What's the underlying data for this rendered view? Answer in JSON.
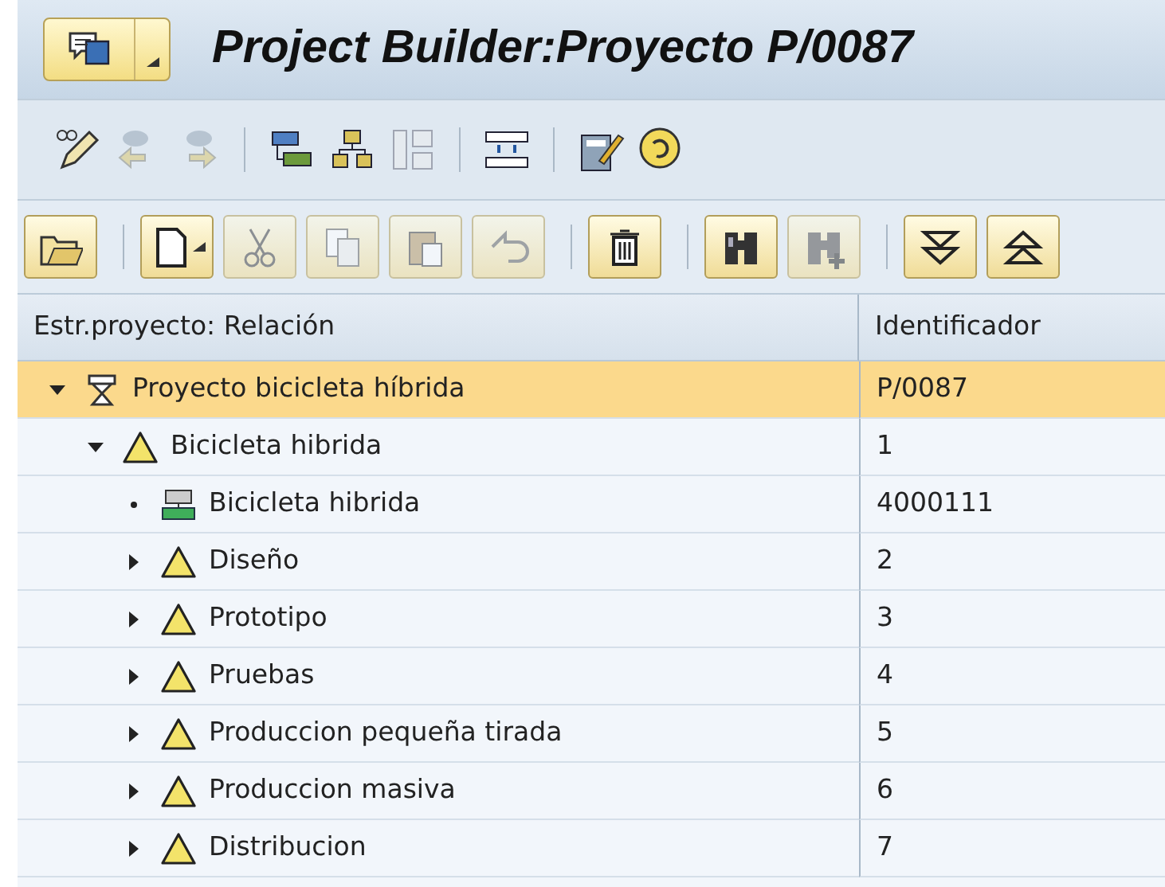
{
  "window": {
    "title": "Project Builder:Proyecto P/0087",
    "menu_button": {
      "disabled": false
    }
  },
  "toolbar": [
    [
      {
        "disabled": false
      },
      {
        "disabled": true
      },
      {
        "disabled": true
      }
    ],
    [
      {
        "disabled": false
      },
      {
        "disabled": false
      },
      {
        "disabled": true
      }
    ],
    [
      {
        "disabled": false
      }
    ],
    [
      {
        "disabled": false
      },
      {
        "disabled": false
      }
    ]
  ],
  "object_toolbar": [
    [
      {
        "disabled": false
      }
    ],
    [
      {
        "disabled": false
      },
      {
        "disabled": true
      },
      {
        "disabled": true
      },
      {
        "disabled": true
      },
      {
        "disabled": true
      }
    ],
    [
      {
        "disabled": false
      }
    ],
    [
      {
        "disabled": false
      },
      {
        "disabled": true
      }
    ],
    [
      {
        "disabled": false
      },
      {
        "disabled": false
      }
    ]
  ],
  "table": {
    "columns": [
      "Estr.proyecto: Relación",
      "Identificador"
    ],
    "rows": [
      {
        "kind": "project",
        "label": "Proyecto bicicleta híbrida",
        "id": "P/0087",
        "expanded": true,
        "selected": true,
        "children": [
          {
            "kind": "wbs",
            "label": "Bicicleta hibrida",
            "id": "1",
            "expanded": true,
            "selected": false,
            "children": [
              {
                "kind": "network",
                "label": "Bicicleta hibrida",
                "id": "4000111",
                "selected": false
              },
              {
                "kind": "wbs",
                "label": "Diseño",
                "id": "2",
                "expanded": false,
                "selected": false
              },
              {
                "kind": "wbs",
                "label": "Prototipo",
                "id": "3",
                "expanded": false,
                "selected": false
              },
              {
                "kind": "wbs",
                "label": "Pruebas",
                "id": "4",
                "expanded": false,
                "selected": false
              },
              {
                "kind": "wbs",
                "label": "Produccion pequeña tirada",
                "id": "5",
                "expanded": false,
                "selected": false
              },
              {
                "kind": "wbs",
                "label": "Produccion masiva",
                "id": "6",
                "expanded": false,
                "selected": false
              },
              {
                "kind": "wbs",
                "label": "Distribucion",
                "id": "7",
                "expanded": false,
                "selected": false
              }
            ]
          }
        ]
      }
    ]
  }
}
